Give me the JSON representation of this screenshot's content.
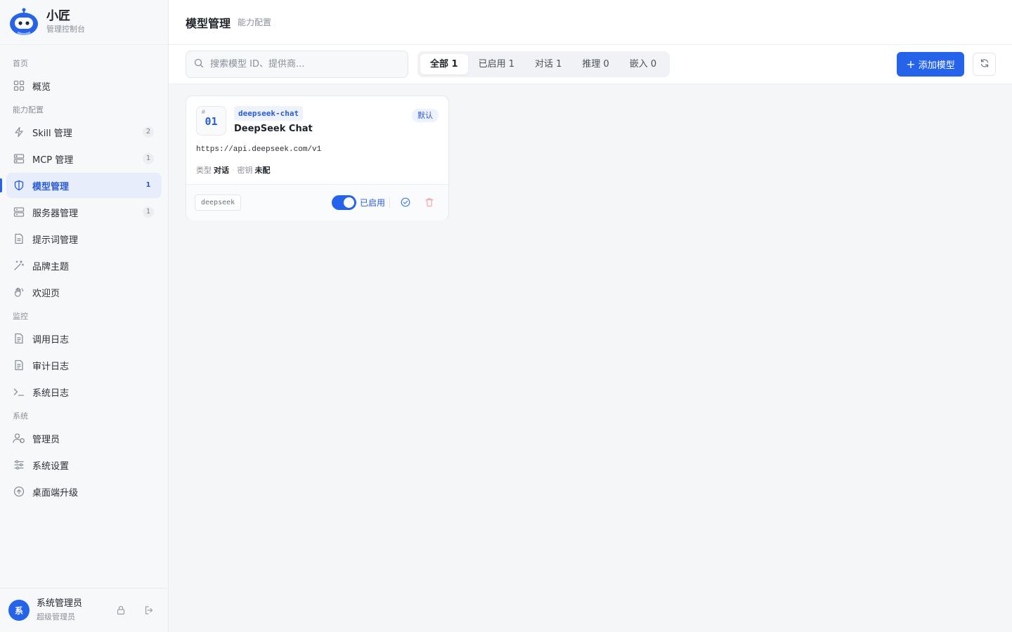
{
  "brand": {
    "name": "小匠",
    "subtitle": "管理控制台"
  },
  "nav": {
    "sections": [
      {
        "title": "首页"
      },
      {
        "title": "能力配置"
      },
      {
        "title": "监控"
      },
      {
        "title": "系统"
      }
    ],
    "items": [
      {
        "label": "概览",
        "icon": "grid-icon"
      },
      {
        "label": "Skill 管理",
        "icon": "lightning-icon",
        "count": "2"
      },
      {
        "label": "MCP 管理",
        "icon": "server-stack-icon",
        "count": "1"
      },
      {
        "label": "模型管理",
        "icon": "shield-icon",
        "count": "1",
        "active": true
      },
      {
        "label": "服务器管理",
        "icon": "server-icon",
        "count": "1"
      },
      {
        "label": "提示词管理",
        "icon": "document-icon"
      },
      {
        "label": "品牌主题",
        "icon": "magic-wand-icon"
      },
      {
        "label": "欢迎页",
        "icon": "wave-hand-icon"
      },
      {
        "label": "调用日志",
        "icon": "log-file-icon"
      },
      {
        "label": "审计日志",
        "icon": "audit-file-icon"
      },
      {
        "label": "系统日志",
        "icon": "terminal-icon"
      },
      {
        "label": "管理员",
        "icon": "users-icon"
      },
      {
        "label": "系统设置",
        "icon": "sliders-icon"
      },
      {
        "label": "桌面端升级",
        "icon": "upgrade-icon"
      }
    ]
  },
  "user": {
    "avatar": "系",
    "name": "系统管理员",
    "role": "超级管理员"
  },
  "header": {
    "title": "模型管理",
    "crumb": "能力配置"
  },
  "toolbar": {
    "search_placeholder": "搜索模型 ID、提供商...",
    "search_value": "",
    "tabs": [
      {
        "label": "全部 1",
        "active": true
      },
      {
        "label": "已启用 1"
      },
      {
        "label": "对话 1"
      },
      {
        "label": "推理 0"
      },
      {
        "label": "嵌入 0"
      }
    ],
    "add_label": "添加模型"
  },
  "models": [
    {
      "hash": "#",
      "index": "01",
      "id": "deepseek-chat",
      "name": "DeepSeek Chat",
      "badge": "默认",
      "endpoint": "https://api.deepseek.com/v1",
      "type_label": "类型",
      "type_value": "对话",
      "key_label": "密钥",
      "key_value": "未配",
      "provider": "deepseek",
      "enabled": true,
      "enabled_label": "已启用"
    }
  ],
  "colors": {
    "accent": "#2563eb",
    "danger": "#f1a5ad",
    "sidebar_bg": "#f7f8fa"
  }
}
